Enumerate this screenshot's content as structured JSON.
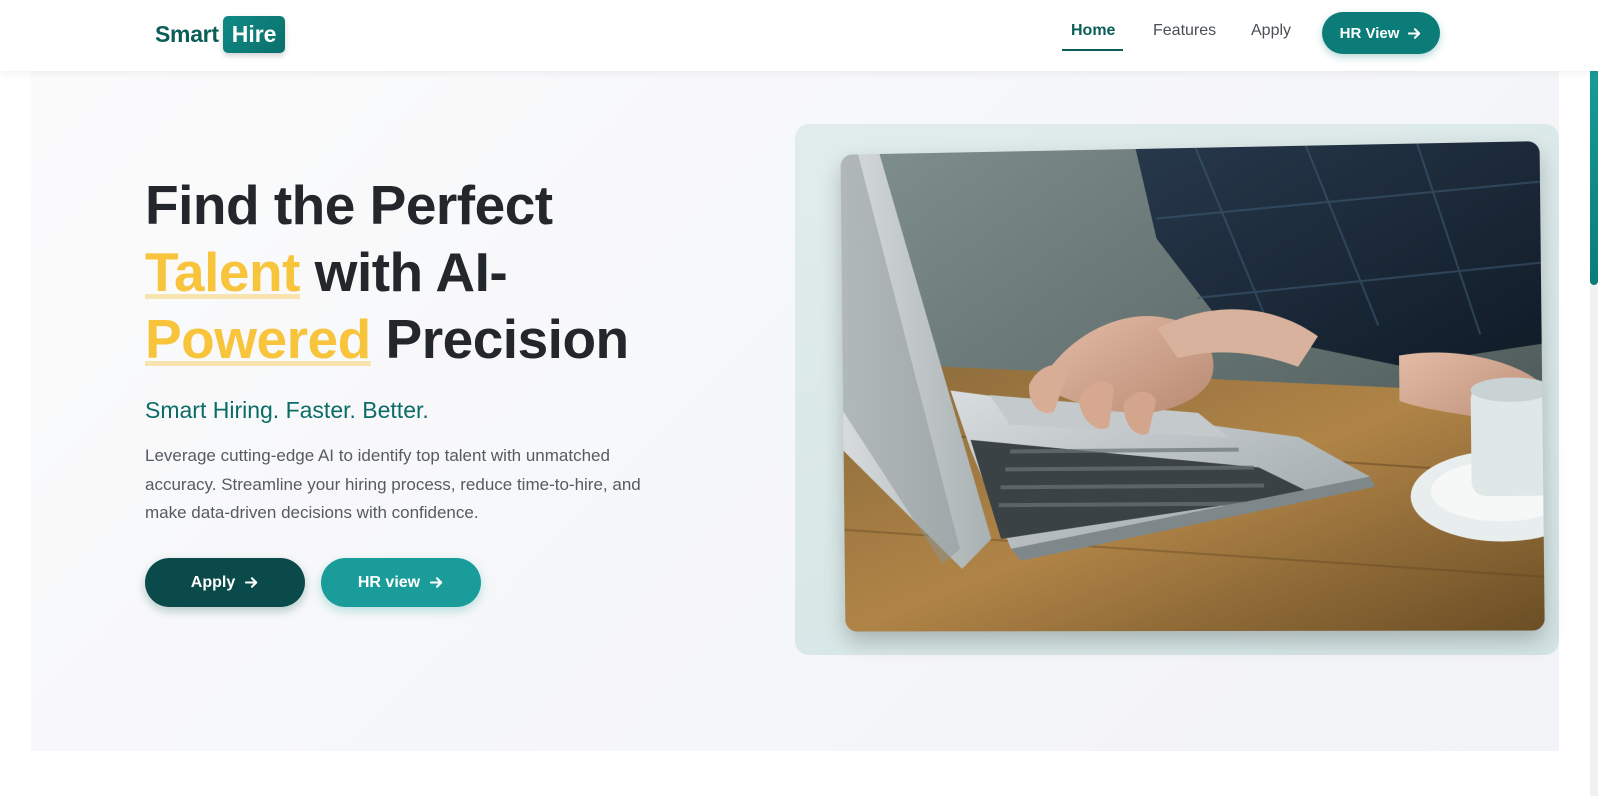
{
  "header": {
    "logo_smart": "Smart",
    "logo_hire": "Hire",
    "nav": [
      {
        "label": "Home"
      },
      {
        "label": "Features"
      },
      {
        "label": "Apply"
      }
    ],
    "cta_label": "HR View",
    "active_nav": "Home"
  },
  "hero": {
    "headline": {
      "line1": "Find the Perfect",
      "line2_highlight": "Talent",
      "line2_rest": " with AI-",
      "line3_highlight": "Powered",
      "line3_rest": " Precision"
    },
    "tagline": "Smart Hiring. Faster. Better.",
    "description": "Leverage cutting-edge AI to identify top talent with unmatched accuracy. Streamline your hiring process, reduce time-to-hire, and make data-driven decisions with confidence.",
    "buttons": [
      {
        "label": "Apply",
        "icon": "arrow-right-icon"
      },
      {
        "label": "HR view",
        "icon": "arrow-right-icon"
      }
    ],
    "image_subject": "laptop-typing-photo"
  },
  "colors": {
    "brand_primary": "#0b7c78",
    "brand_dark": "#0b4a4a",
    "accent_yellow": "#f7c43b",
    "text_dark": "#23262b",
    "tagline": "#0b6c67"
  }
}
